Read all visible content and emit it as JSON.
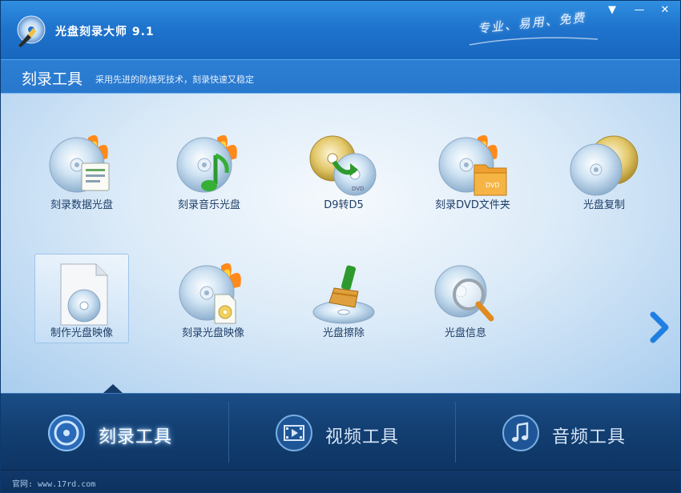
{
  "window": {
    "title": "光盘刻录大师 9.1",
    "slogan": "专业、易用、免费",
    "controls": {
      "menu": "▼",
      "minimize": "—",
      "close": "✕"
    }
  },
  "section": {
    "title": "刻录工具",
    "subtitle": "采用先进的防烧死技术，刻录快速又稳定"
  },
  "tools": [
    {
      "id": "burn-data-disc",
      "label": "刻录数据光盘"
    },
    {
      "id": "burn-music-disc",
      "label": "刻录音乐光盘"
    },
    {
      "id": "d9-to-d5",
      "label": "D9转D5",
      "dvd_text": "DVD"
    },
    {
      "id": "burn-dvd-folder",
      "label": "刻录DVD文件夹",
      "folder_text": "DVD"
    },
    {
      "id": "copy-disc",
      "label": "光盘复制"
    },
    {
      "id": "make-disc-image",
      "label": "制作光盘映像",
      "selected": true
    },
    {
      "id": "burn-disc-image",
      "label": "刻录光盘映像"
    },
    {
      "id": "erase-disc",
      "label": "光盘擦除"
    },
    {
      "id": "disc-info",
      "label": "光盘信息"
    }
  ],
  "tabs": [
    {
      "label": "刻录工具",
      "icon": "disc-icon",
      "active": true
    },
    {
      "label": "视频工具",
      "icon": "film-icon",
      "active": false
    },
    {
      "label": "音频工具",
      "icon": "music-note-icon",
      "active": false
    }
  ],
  "statusbar": {
    "text": "官网: www.17rd.com"
  },
  "colors": {
    "titlebar": "#1f74cd",
    "content_bg": "#dcebf8",
    "tabbar": "#123e71",
    "accent_arrow": "#1f7fe0"
  }
}
